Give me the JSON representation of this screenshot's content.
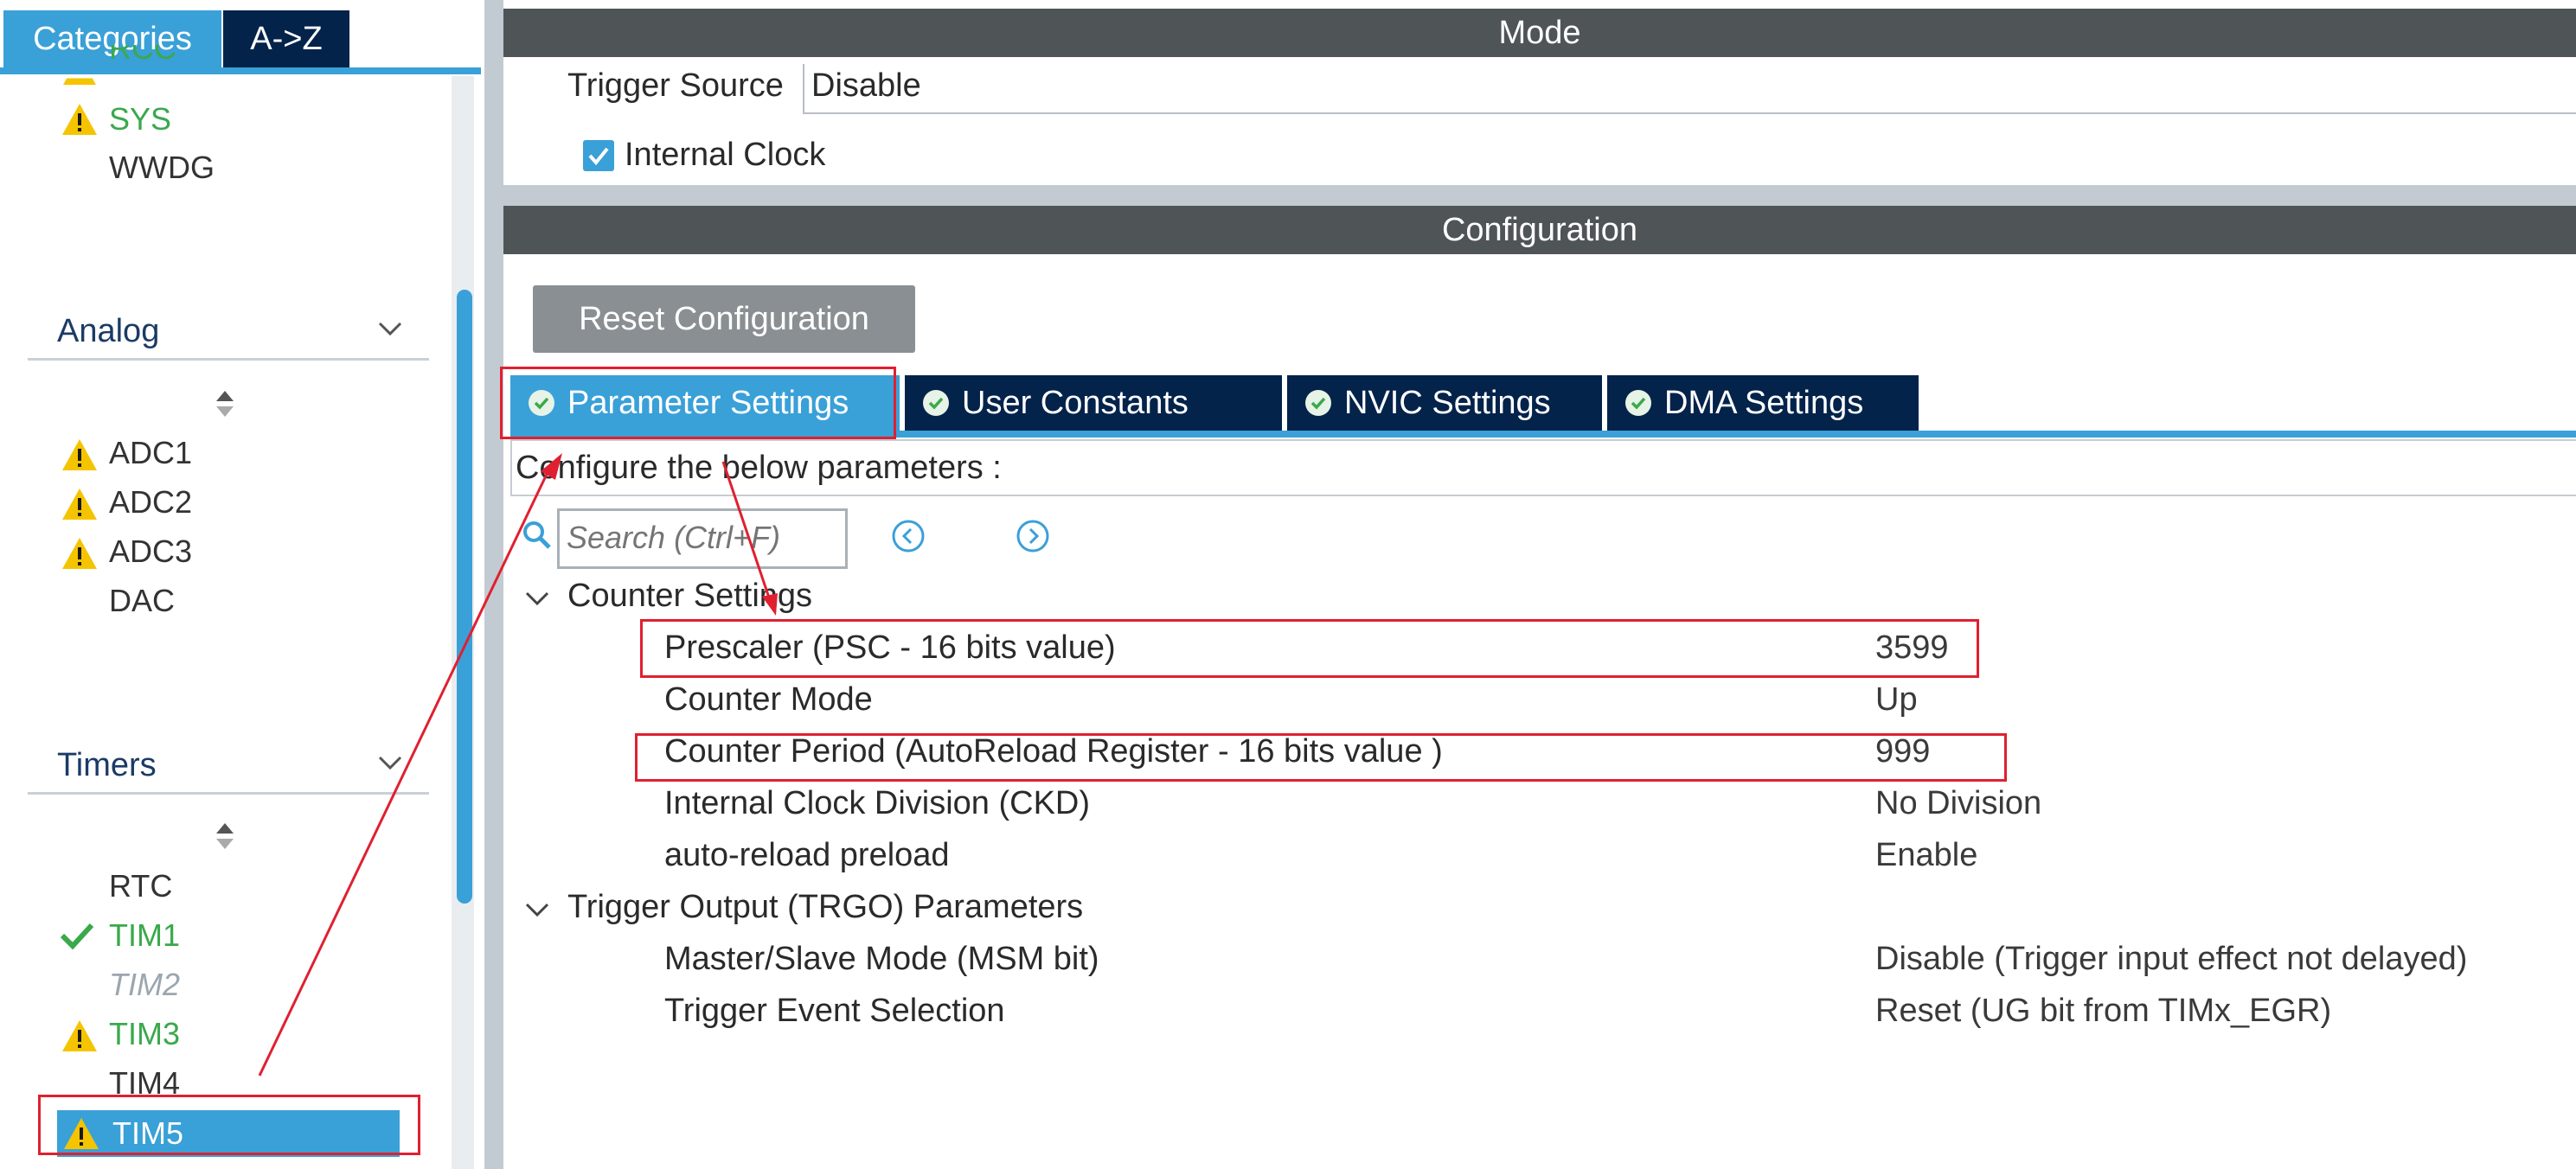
{
  "left_panel": {
    "tabs": {
      "categories": "Categories",
      "az": "A->Z"
    },
    "top_items": [
      {
        "label": "RCC",
        "status": "warning"
      },
      {
        "label": "SYS",
        "status": "warning"
      },
      {
        "label": "WWDG",
        "status": "none"
      }
    ],
    "analog": {
      "title": "Analog",
      "items": [
        {
          "label": "ADC1",
          "status": "warning"
        },
        {
          "label": "ADC2",
          "status": "warning"
        },
        {
          "label": "ADC3",
          "status": "warning"
        },
        {
          "label": "DAC",
          "status": "none"
        }
      ]
    },
    "timers": {
      "title": "Timers",
      "items": [
        {
          "label": "RTC",
          "status": "none"
        },
        {
          "label": "TIM1",
          "status": "ok"
        },
        {
          "label": "TIM2",
          "status": "disabled"
        },
        {
          "label": "TIM3",
          "status": "warning"
        },
        {
          "label": "TIM4",
          "status": "none"
        },
        {
          "label": "TIM5",
          "status": "selected-warning"
        }
      ]
    }
  },
  "mode": {
    "title": "Mode",
    "trigger_source_label": "Trigger Source",
    "trigger_source_value": "Disable",
    "internal_clock_label": "Internal Clock",
    "internal_clock_checked": true
  },
  "configuration": {
    "title": "Configuration",
    "reset_button": "Reset Configuration",
    "tabs": [
      {
        "label": "Parameter Settings",
        "active": true
      },
      {
        "label": "User Constants",
        "active": false
      },
      {
        "label": "NVIC Settings",
        "active": false
      },
      {
        "label": "DMA Settings",
        "active": false
      }
    ],
    "configure_text": "Configure the below parameters :",
    "search_placeholder": "Search (Ctrl+F)",
    "groups": [
      {
        "title": "Counter Settings",
        "params": [
          {
            "name": "Prescaler (PSC - 16 bits value)",
            "value": "3599"
          },
          {
            "name": "Counter Mode",
            "value": "Up"
          },
          {
            "name": "Counter Period (AutoReload Register - 16 bits value )",
            "value": "999"
          },
          {
            "name": "Internal Clock Division (CKD)",
            "value": "No Division"
          },
          {
            "name": "auto-reload preload",
            "value": "Enable"
          }
        ]
      },
      {
        "title": "Trigger Output (TRGO) Parameters",
        "params": [
          {
            "name": "Master/Slave Mode (MSM bit)",
            "value": "Disable (Trigger input effect not delayed)"
          },
          {
            "name": "Trigger Event Selection",
            "value": "Reset (UG bit from TIMx_EGR)"
          }
        ]
      }
    ]
  },
  "colors": {
    "accent_blue": "#3aa0d8",
    "navy": "#03234b",
    "section_bar": "#4f5457",
    "ok_green": "#3aa94c",
    "warning_yellow": "#f5c400",
    "annotation_red": "#e02030"
  }
}
